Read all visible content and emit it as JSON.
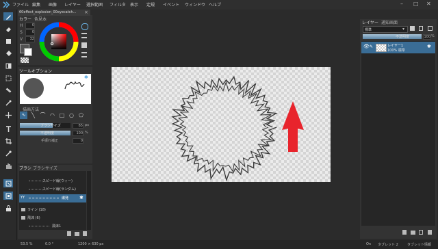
{
  "menubar": {
    "items": [
      "ファイル",
      "編集",
      "画像",
      "レイヤー",
      "選択範囲",
      "フィルタ",
      "表示",
      "定規",
      "イベント",
      "ウィンドウ",
      "ヘルプ"
    ],
    "window_buttons": [
      "–",
      "□",
      "✕"
    ]
  },
  "document_tab": {
    "title": "60effect_explosion_00eyecatch...",
    "close": "×"
  },
  "color_panel": {
    "tabs": [
      "カラー",
      "色見本"
    ],
    "labels": [
      "H",
      "S",
      "V"
    ],
    "values": [
      "0",
      "0",
      "32"
    ]
  },
  "tool_options": {
    "title": "ツールオプション",
    "drawing_method_label": "描画方法",
    "sliders": [
      {
        "label": "ブラシサイズ",
        "value": "65",
        "unit": "px",
        "level": 0.65
      },
      {
        "label": "不透明度",
        "value": "100",
        "unit": "%",
        "level": 1.0
      }
    ],
    "stabilizer": {
      "label": "手振れ補正",
      "value": "0"
    }
  },
  "brush_panel": {
    "tabs": [
      "ブラシ",
      "ブラシサイズ"
    ],
    "items": [
      {
        "name": "スピード線(ウィー)"
      },
      {
        "name": "スピード線(ランダム)"
      },
      {
        "name": "爆発",
        "selected": true
      }
    ],
    "groups": [
      {
        "name": "ライン (18)"
      },
      {
        "name": "飛沫 (6)"
      }
    ],
    "sub_items": [
      "飛沫1"
    ]
  },
  "layer_panel": {
    "tabs": [
      "レイヤー",
      "通知画面"
    ],
    "blend_mode": "標準",
    "opacity_label": "不透明度",
    "opacity_value": "100",
    "opacity_unit": "%",
    "layers": [
      {
        "name": "レイヤー1",
        "info": "100% 標準"
      }
    ]
  },
  "status_bar": {
    "zoom": "53.5 %",
    "angle": "0.0 °",
    "size": "1200 × 630 px",
    "on": "On",
    "tablet": "タブレット 2",
    "tablet_info": "タブレット情報"
  },
  "colors": {
    "accent": "#3a6d96",
    "arrow": "#e8242c",
    "explosion": "#3c3c3c"
  }
}
